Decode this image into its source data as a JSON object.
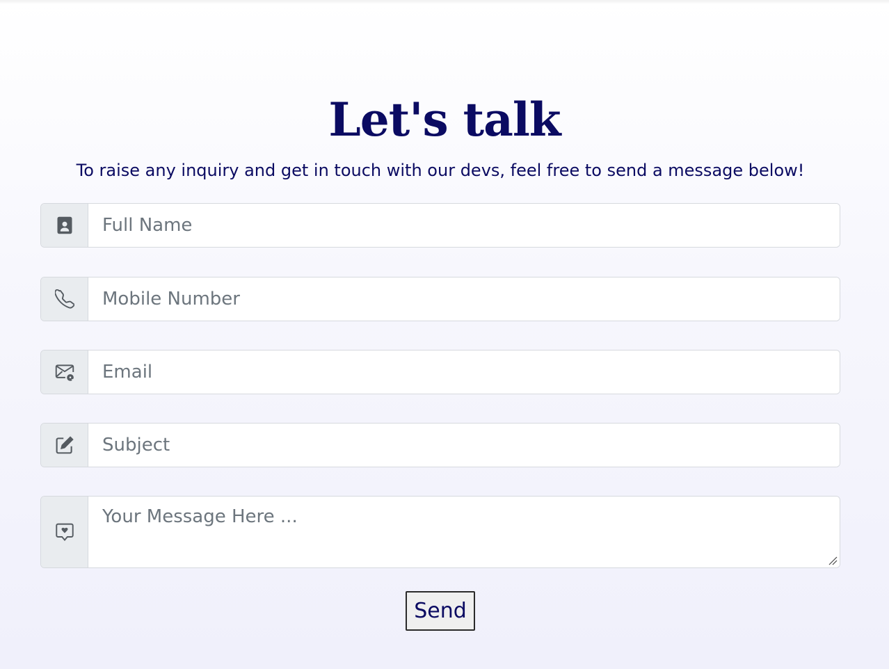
{
  "contact": {
    "heading": "Let's talk",
    "subtitle": "To raise any inquiry and get in touch with our devs, feel free to send a message below!",
    "fields": [
      {
        "icon": "person-badge-icon",
        "placeholder": "Full Name",
        "value": ""
      },
      {
        "icon": "telephone-icon",
        "placeholder": "Mobile Number",
        "value": ""
      },
      {
        "icon": "envelope-at-icon",
        "placeholder": "Email",
        "value": ""
      },
      {
        "icon": "pencil-square-icon",
        "placeholder": "Subject",
        "value": ""
      },
      {
        "icon": "chat-heart-icon",
        "placeholder": "Your Message Here ...",
        "value": ""
      }
    ],
    "send_label": "Send"
  },
  "colors": {
    "heading": "#0b0b62",
    "addon_bg": "#e9ecef",
    "border": "#d6d9de",
    "placeholder": "#6c757d",
    "icon": "#555b61"
  }
}
